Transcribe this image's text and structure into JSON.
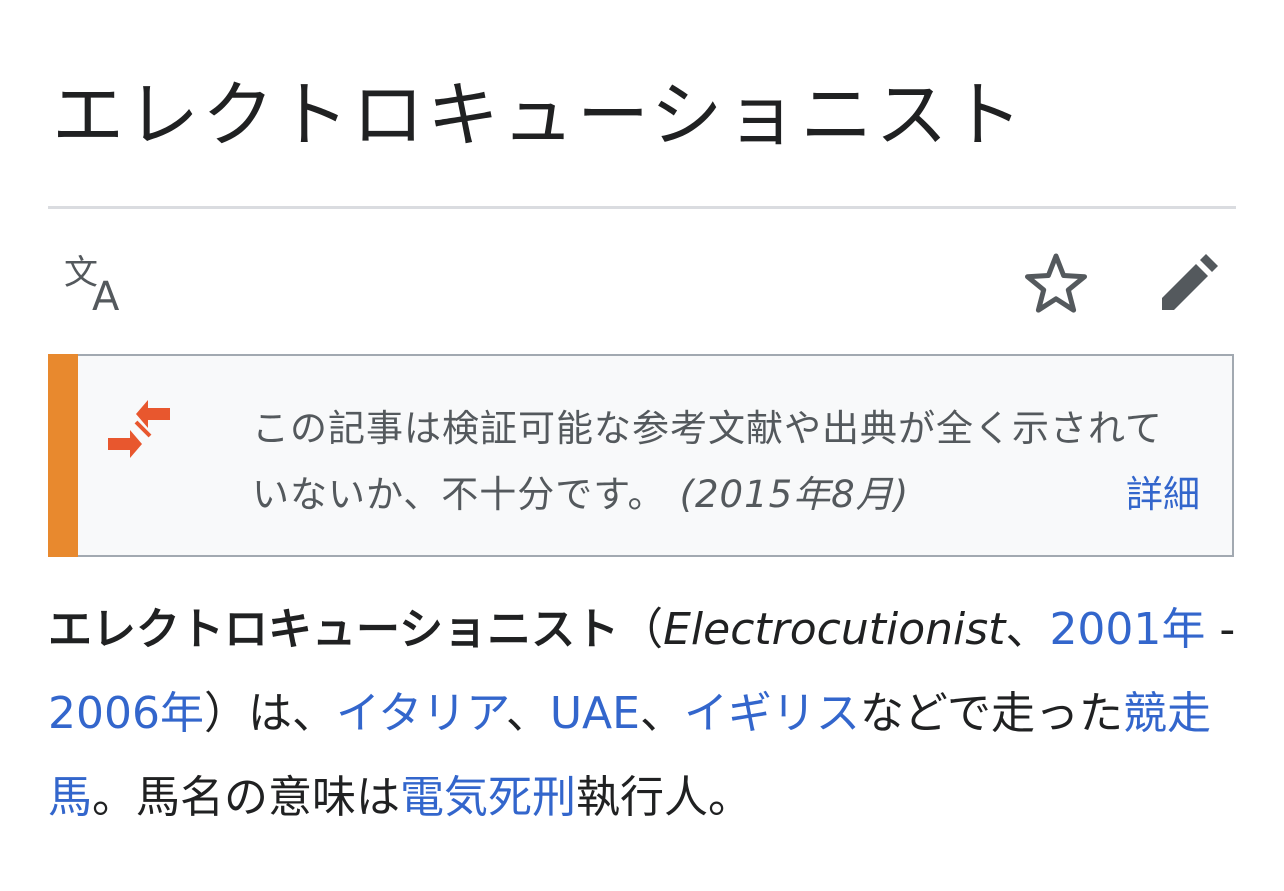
{
  "page": {
    "title": "エレクトロキューショニスト"
  },
  "toolbar": {
    "language_icon": "translate-icon",
    "watch_icon": "star-icon",
    "edit_icon": "pencil-icon"
  },
  "notice": {
    "icon": "merge-arrows-icon",
    "accent_color": "#e8892e",
    "message": "この記事は検証可能な参考文献や出典が全く示されていないか、不十分です。",
    "date": "(2015年8月)",
    "more_link": "詳細"
  },
  "article": {
    "subject": "エレクトロキューショニスト",
    "open_paren": "（",
    "english_name": "Electrocutionist",
    "comma1": "、",
    "birth_year_link": "2001年",
    "dash": " - ",
    "death_year_link": "2006年",
    "close_paren": "）",
    "text_wa": "は、",
    "country1": "イタリア",
    "sep1": "、",
    "country2": "UAE",
    "sep2": "、",
    "country3": "イギリス",
    "text_ran": "などで走った",
    "racehorse_link": "競走馬",
    "text_meaning": "。馬名の意味は",
    "electric_chair_link": "電気死刑",
    "text_end": "執行人。"
  },
  "colors": {
    "link": "#3366cc",
    "text": "#202122",
    "notice_text": "#54595d",
    "divider": "#dadce0"
  }
}
